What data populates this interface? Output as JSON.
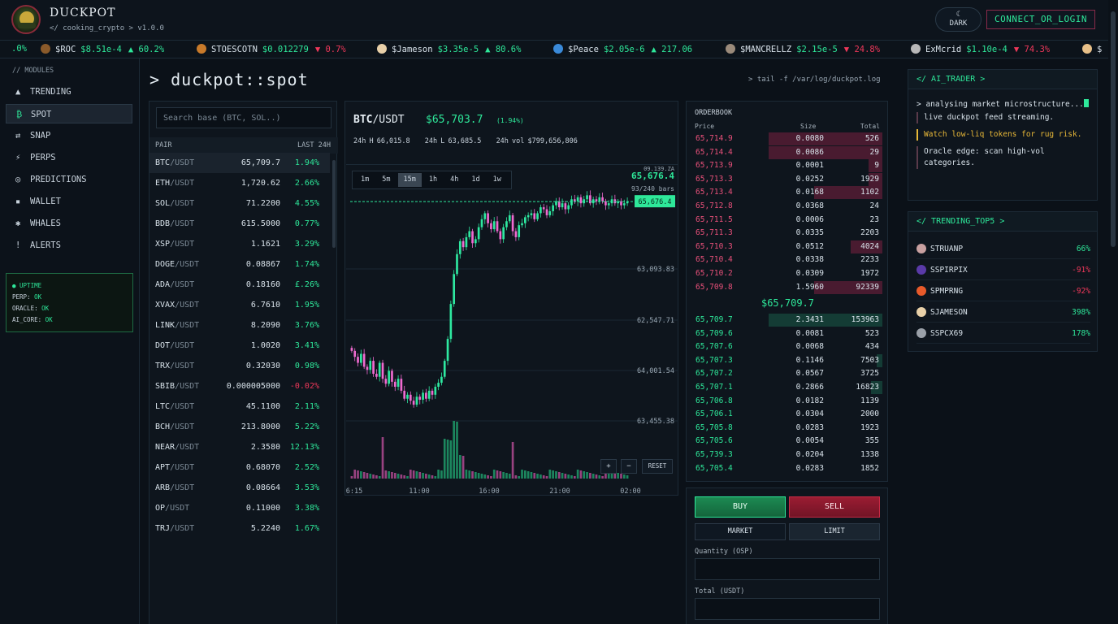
{
  "header": {
    "brand": "DUCKPOT",
    "subtitle": "</ cooking_crypto > v1.0.0",
    "theme_icon": "☾",
    "theme_label": "DARK",
    "connect_label": "CONNECT_OR_LOGIN"
  },
  "ticker": [
    {
      "sym": "",
      "price": "",
      "arrow": "",
      "chg": ".0%",
      "dir": "up",
      "icon_color": "#000000"
    },
    {
      "sym": "$ROC",
      "price": "$8.51e-4",
      "arrow": "▲",
      "chg": "60.2%",
      "dir": "up",
      "icon_color": "#8a5a2a"
    },
    {
      "sym": "STOESCOTN",
      "price": "$0.012279",
      "arrow": "▼",
      "chg": "0.7%",
      "dir": "dn",
      "icon_color": "#c87a2a"
    },
    {
      "sym": "$Jameson",
      "price": "$3.35e-5",
      "arrow": "▲",
      "chg": "80.6%",
      "dir": "up",
      "icon_color": "#e8d0a8"
    },
    {
      "sym": "$Peace",
      "price": "$2.05e-6",
      "arrow": "▲",
      "chg": "217.06",
      "dir": "up",
      "icon_color": "#3a8ad8"
    },
    {
      "sym": "$MANCRELLZ",
      "price": "$2.15e-5",
      "arrow": "▼",
      "chg": "24.8%",
      "dir": "dn",
      "icon_color": "#9a8a7a"
    },
    {
      "sym": "ExMcrid",
      "price": "$1.10e-4",
      "arrow": "▼",
      "chg": "74.3%",
      "dir": "dn",
      "icon_color": "#b8b8b8"
    },
    {
      "sym": "$",
      "price": "",
      "arrow": "",
      "chg": "",
      "dir": "up",
      "icon_color": "#e8c088"
    }
  ],
  "sidebar": {
    "label": "// MODULES",
    "items": [
      {
        "icon": "▲",
        "label": "TRENDING",
        "name": "trending"
      },
      {
        "icon": "₿",
        "label": "SPOT",
        "name": "spot",
        "active": true
      },
      {
        "icon": "⇄",
        "label": "SNAP",
        "name": "snap"
      },
      {
        "icon": "⚡",
        "label": "PERPS",
        "name": "perps"
      },
      {
        "icon": "◎",
        "label": "PREDICTIONS",
        "name": "predictions"
      },
      {
        "icon": "▪",
        "label": "WALLET",
        "name": "wallet"
      },
      {
        "icon": "✱",
        "label": "WHALES",
        "name": "whales"
      },
      {
        "icon": "!",
        "label": "ALERTS",
        "name": "alerts"
      }
    ],
    "uptime": {
      "title": "● UPTIME",
      "rows": [
        {
          "k": "PERP:",
          "v": "OK"
        },
        {
          "k": "ORACLE:",
          "v": "OK"
        },
        {
          "k": "AI_CORE:",
          "v": "OK"
        }
      ]
    }
  },
  "main": {
    "title": "> duckpot::spot",
    "log_path": "> tail -f /var/log/duckpot.log"
  },
  "pairs": {
    "search_placeholder": "Search base (BTC, SOL..)",
    "col_pair": "PAIR",
    "col_last": "LAST 24H",
    "rows": [
      {
        "base": "BTC",
        "quote": "/USDT",
        "last": "65,709.7",
        "chg": "1.94%",
        "dir": "up",
        "selected": true
      },
      {
        "base": "ETH",
        "quote": "/USDT",
        "last": "1,720.62",
        "chg": "2.66%",
        "dir": "up"
      },
      {
        "base": "SOL",
        "quote": "/USDT",
        "last": "71.2200",
        "chg": "4.55%",
        "dir": "up"
      },
      {
        "base": "BDB",
        "quote": "/USDT",
        "last": "615.5000",
        "chg": "0.77%",
        "dir": "up"
      },
      {
        "base": "XSP",
        "quote": "/USDT",
        "last": "1.1621",
        "chg": "3.29%",
        "dir": "up"
      },
      {
        "base": "DOGE",
        "quote": "/USDT",
        "last": "0.08867",
        "chg": "1.74%",
        "dir": "up"
      },
      {
        "base": "ADA",
        "quote": "/USDT",
        "last": "0.18160",
        "chg": "£.26%",
        "dir": "up"
      },
      {
        "base": "XVAX",
        "quote": "/USDT",
        "last": "6.7610",
        "chg": "1.95%",
        "dir": "up"
      },
      {
        "base": "LINK",
        "quote": "/USDT",
        "last": "8.2090",
        "chg": "3.76%",
        "dir": "up"
      },
      {
        "base": "DOT",
        "quote": "/USDT",
        "last": "1.0020",
        "chg": "3.41%",
        "dir": "up"
      },
      {
        "base": "TRX",
        "quote": "/USDT",
        "last": "0.32030",
        "chg": "0.98%",
        "dir": "up"
      },
      {
        "base": "SBIB",
        "quote": "/USDT",
        "last": "0.000005000",
        "chg": "-0.02%",
        "dir": "dn"
      },
      {
        "base": "LTC",
        "quote": "/USDT",
        "last": "45.1100",
        "chg": "2.11%",
        "dir": "up"
      },
      {
        "base": "BCH",
        "quote": "/USDT",
        "last": "213.8000",
        "chg": "5.22%",
        "dir": "up"
      },
      {
        "base": "NEAR",
        "quote": "/USDT",
        "last": "2.3580",
        "chg": "12.13%",
        "dir": "up"
      },
      {
        "base": "APT",
        "quote": "/USDT",
        "last": "0.68070",
        "chg": "2.52%",
        "dir": "up"
      },
      {
        "base": "ARB",
        "quote": "/USDT",
        "last": "0.08664",
        "chg": "3.53%",
        "dir": "up"
      },
      {
        "base": "OP",
        "quote": "/USDT",
        "last": "0.11000",
        "chg": "3.38%",
        "dir": "up"
      },
      {
        "base": "TRJ",
        "quote": "/USDT",
        "last": "5.2240",
        "chg": "1.67%",
        "dir": "up"
      }
    ]
  },
  "chart": {
    "base": "BTC",
    "quote": "/USDT",
    "price": "$65,703.7",
    "change": "(1.94%)",
    "stat_high": "24h H 66,015.8",
    "stat_low": "24h L 63,685.5",
    "stat_vol": "24h vol $799,656,806",
    "timeframes": [
      "1m",
      "5m",
      "15m",
      "1h",
      "4h",
      "1d",
      "1w"
    ],
    "active_tf": "15m",
    "info_time": "09.139.ZA",
    "info_price": "65,676.4",
    "info_bars": "93/240 bars",
    "last_label": "65,676.4",
    "zoom_in": "+",
    "zoom_out": "−",
    "reset": "RESET"
  },
  "chart_data": {
    "type": "candlestick",
    "title": "",
    "y_ticks": [
      "63,093.83",
      "62,547.71",
      "64,001.54",
      "63,455.38"
    ],
    "x_ticks": [
      "6:15",
      "11:00",
      "16:00",
      "21:00",
      "02:00"
    ],
    "last_price": 65676.4,
    "close_series": [
      64180,
      64120,
      64060,
      64150,
      64020,
      63990,
      64080,
      63950,
      63920,
      64060,
      63900,
      63850,
      63980,
      63870,
      63820,
      63900,
      63780,
      63700,
      63740,
      63680,
      63640,
      63720,
      63690,
      63760,
      63700,
      63780,
      63740,
      63820,
      63860,
      63920,
      64080,
      64300,
      64650,
      64950,
      65150,
      65280,
      65220,
      65320,
      65380,
      65260,
      65300,
      65420,
      65500,
      65560,
      65460,
      65400,
      65480,
      65380,
      65300,
      65420,
      65480,
      65540,
      65380,
      65320,
      65440,
      65460,
      65520,
      65540,
      65560,
      65500,
      65560,
      65620,
      65600,
      65540,
      65580,
      65640,
      65680,
      65620,
      65660,
      65600,
      65640,
      65700,
      65680,
      65720,
      65660,
      65700,
      65740,
      65660,
      65700,
      65680,
      65720,
      65680,
      65640,
      65660,
      65700,
      65660,
      65680,
      65640,
      65660,
      65676
    ]
  },
  "orderbook": {
    "title": "ORDERBOOK",
    "col_price": "Price",
    "col_size": "Size",
    "col_total": "Total",
    "asks": [
      {
        "p": "65,714.9",
        "s": "0.0080",
        "t": "526",
        "depth": 100
      },
      {
        "p": "65,714.4",
        "s": "0.0086",
        "t": "29",
        "depth": 100
      },
      {
        "p": "65,713.9",
        "s": "0.0001",
        "t": "9",
        "depth": 12
      },
      {
        "p": "65,713.3",
        "s": "0.0252",
        "t": "1929",
        "depth": 12
      },
      {
        "p": "65,713.4",
        "s": "0.0168",
        "t": "1102",
        "depth": 60
      },
      {
        "p": "65,712.8",
        "s": "0.0368",
        "t": "24",
        "depth": 0
      },
      {
        "p": "65,711.5",
        "s": "0.0006",
        "t": "23",
        "depth": 0
      },
      {
        "p": "65,711.3",
        "s": "0.0335",
        "t": "2203",
        "depth": 0
      },
      {
        "p": "65,710.3",
        "s": "0.0512",
        "t": "4024",
        "depth": 28
      },
      {
        "p": "65,710.4",
        "s": "0.0338",
        "t": "2233",
        "depth": 0
      },
      {
        "p": "65,710.2",
        "s": "0.0309",
        "t": "1972",
        "depth": 0
      },
      {
        "p": "65,709.8",
        "s": "1.5960",
        "t": "92339",
        "depth": 60
      }
    ],
    "mid": "$65,709.7",
    "bids": [
      {
        "p": "65,709.7",
        "s": "2.3431",
        "t": "153963",
        "depth": 100
      },
      {
        "p": "65,709.6",
        "s": "0.0081",
        "t": "523",
        "depth": 0
      },
      {
        "p": "65,707.6",
        "s": "0.0068",
        "t": "434",
        "depth": 0
      },
      {
        "p": "65,707.3",
        "s": "0.1146",
        "t": "7503",
        "depth": 5
      },
      {
        "p": "65,707.2",
        "s": "0.0567",
        "t": "3725",
        "depth": 0
      },
      {
        "p": "65,707.1",
        "s": "0.2866",
        "t": "16823",
        "depth": 10
      },
      {
        "p": "65,706.8",
        "s": "0.0182",
        "t": "1139",
        "depth": 0
      },
      {
        "p": "65,706.1",
        "s": "0.0304",
        "t": "2000",
        "depth": 0
      },
      {
        "p": "65,705.8",
        "s": "0.0283",
        "t": "1923",
        "depth": 0
      },
      {
        "p": "65,705.6",
        "s": "0.0054",
        "t": "355",
        "depth": 0
      },
      {
        "p": "65,739.3",
        "s": "0.0204",
        "t": "1338",
        "depth": 0
      },
      {
        "p": "65,705.4",
        "s": "0.0283",
        "t": "1852",
        "depth": 0
      }
    ]
  },
  "order_form": {
    "buy": "BUY",
    "sell": "SELL",
    "market": "MARKET",
    "limit": "LIMIT",
    "qty_label": "Quantity (OSP)",
    "total_label": "Total (USDT)"
  },
  "ai_trader": {
    "title": "</ AI_TRADER >",
    "line1": "> analysing market microstructure...",
    "note1": "live duckpot feed streaming.",
    "note2": "Watch low-liq tokens for rug risk.",
    "note3": "Oracle edge: scan high-vol categories."
  },
  "trending": {
    "title": "</ TRENDING_TOP5 >",
    "items": [
      {
        "name": "STRUANP",
        "chg": "66%",
        "dir": "up",
        "icon_color": "#c8a0a0"
      },
      {
        "name": "SSPIRPIX",
        "chg": "-91%",
        "dir": "dn",
        "icon_color": "#5a3aa8"
      },
      {
        "name": "SPMPRNG",
        "chg": "-92%",
        "dir": "dn",
        "icon_color": "#e85a2a"
      },
      {
        "name": "SJAMESON",
        "chg": "398%",
        "dir": "up",
        "icon_color": "#e8d0a8"
      },
      {
        "name": "SSPCX69",
        "chg": "178%",
        "dir": "up",
        "icon_color": "#9aa0a8"
      }
    ]
  },
  "colors": {
    "up": "#2ee89a",
    "down": "#f0385a",
    "accent_border": "#8a2a4a"
  }
}
